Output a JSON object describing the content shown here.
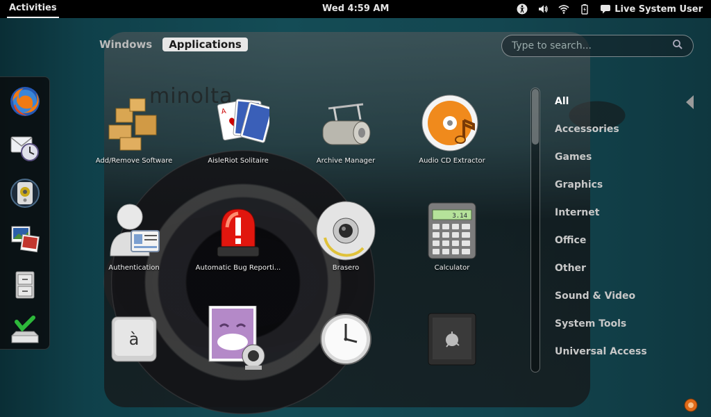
{
  "topbar": {
    "activities": "Activities",
    "clock": "Wed  4:59 AM",
    "user": "Live System User",
    "icons": [
      "accessibility-icon",
      "volume-icon",
      "wifi-icon",
      "battery-icon",
      "chat-icon"
    ]
  },
  "view_tabs": [
    {
      "label": "Windows",
      "active": false
    },
    {
      "label": "Applications",
      "active": true
    }
  ],
  "search": {
    "placeholder": "Type to search..."
  },
  "background": {
    "brand": "minolta"
  },
  "dash": {
    "items": [
      "firefox-icon",
      "evolution-mail-icon",
      "rhythmbox-icon",
      "shotwell-icon",
      "file-manager-icon",
      "install-icon"
    ]
  },
  "apps": [
    {
      "label": "Add/Remove Software",
      "icon": "package-icon"
    },
    {
      "label": "AisleRiot Solitaire",
      "icon": "cards-icon"
    },
    {
      "label": "Archive Manager",
      "icon": "archive-icon"
    },
    {
      "label": "Audio CD Extractor",
      "icon": "audio-cd-icon"
    },
    {
      "label": "Authentication",
      "icon": "authentication-icon"
    },
    {
      "label": "Automatic Bug Reporti...",
      "icon": "alarm-icon"
    },
    {
      "label": "Brasero",
      "icon": "disc-burner-icon"
    },
    {
      "label": "Calculator",
      "icon": "calculator-icon"
    },
    {
      "label": "",
      "icon": "character-map-icon"
    },
    {
      "label": "",
      "icon": "cheese-icon"
    },
    {
      "label": "",
      "icon": "clock-icon"
    },
    {
      "label": "",
      "icon": "safe-icon"
    }
  ],
  "calculator_display": "3.14",
  "character_map_glyph": "à",
  "categories": [
    {
      "label": "All",
      "active": true
    },
    {
      "label": "Accessories",
      "active": false
    },
    {
      "label": "Games",
      "active": false
    },
    {
      "label": "Graphics",
      "active": false
    },
    {
      "label": "Internet",
      "active": false
    },
    {
      "label": "Office",
      "active": false
    },
    {
      "label": "Other",
      "active": false
    },
    {
      "label": "Sound & Video",
      "active": false
    },
    {
      "label": "System Tools",
      "active": false
    },
    {
      "label": "Universal Access",
      "active": false
    }
  ]
}
